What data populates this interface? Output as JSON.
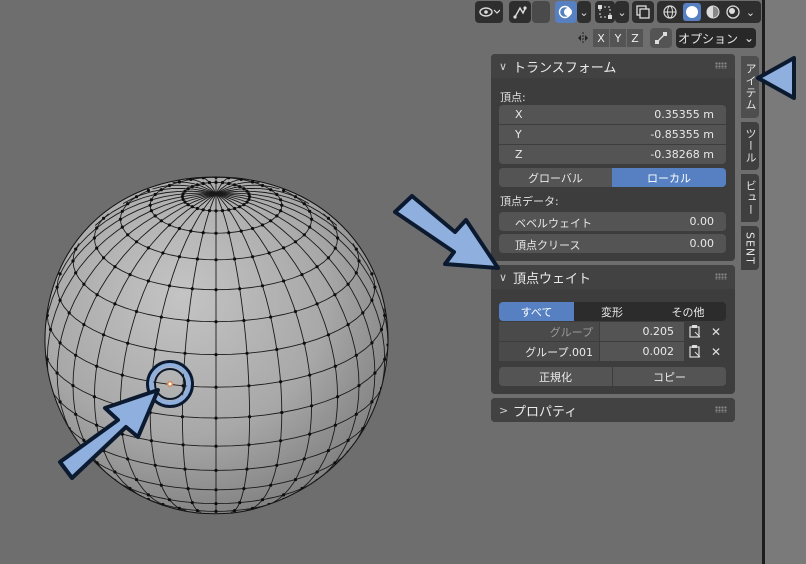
{
  "options_label": "オプション",
  "axes": [
    "X",
    "Y",
    "Z"
  ],
  "transform": {
    "title": "トランスフォーム",
    "vertex_label": "頂点:",
    "rows": [
      {
        "axis": "X",
        "value": "0.35355 m"
      },
      {
        "axis": "Y",
        "value": "-0.85355 m"
      },
      {
        "axis": "Z",
        "value": "-0.38268 m"
      }
    ],
    "global_label": "グローバル",
    "local_label": "ローカル",
    "vertex_data_label": "頂点データ:",
    "bevel_weight_label": "ベベルウェイト",
    "bevel_weight_value": "0.00",
    "crease_label": "頂点クリース",
    "crease_value": "0.00"
  },
  "vertex_weights": {
    "title": "頂点ウェイト",
    "tabs": [
      "すべて",
      "変形",
      "その他"
    ],
    "groups": [
      {
        "name": "グループ",
        "value": "0.205"
      },
      {
        "name": "グループ.001",
        "value": "0.002"
      }
    ],
    "normalize_label": "正規化",
    "copy_label": "コピー"
  },
  "properties": {
    "title": "プロパティ"
  },
  "side_tabs": [
    "アイテム",
    "ツール",
    "ビュー",
    "SENT"
  ],
  "colors": {
    "accent": "#5680c2",
    "annotation_arrow": "#8fb0de",
    "panel": "#3d3d3d",
    "viewport": "#6e6e6e"
  }
}
